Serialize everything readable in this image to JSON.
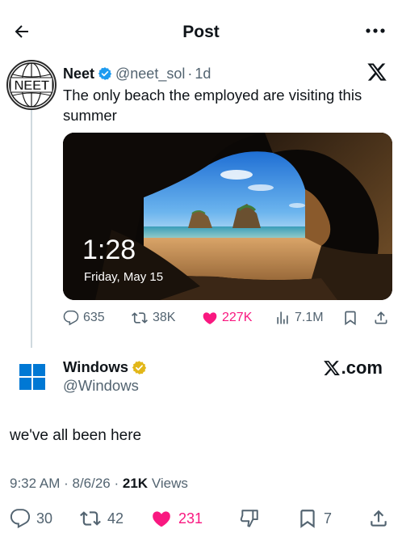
{
  "header": {
    "title": "Post"
  },
  "quoted_post": {
    "author_name": "Neet",
    "handle": "@neet_sol",
    "age": "1d",
    "avatar_text": "NEET",
    "text": "The only beach the employed are visiting this summer",
    "media": {
      "lock_time": "1:28",
      "lock_date": "Friday, May 15"
    },
    "stats": {
      "replies": "635",
      "reposts": "38K",
      "likes": "227K",
      "views": "7.1M"
    }
  },
  "post": {
    "author_name": "Windows",
    "handle": "@Windows",
    "badge": ".com",
    "text": "we've all been here",
    "time": "9:32 AM",
    "date": "8/6/26",
    "views_count": "21K",
    "views_label": "Views",
    "stats": {
      "replies": "30",
      "reposts": "42",
      "likes": "231",
      "bookmarks": "7"
    }
  },
  "colors": {
    "text_primary": "#0f1419",
    "text_secondary": "#536471",
    "like_pink": "#f91880",
    "verified_blue": "#1d9bf0",
    "verified_gold": "#e2b719",
    "windows_blue": "#0078d4"
  }
}
